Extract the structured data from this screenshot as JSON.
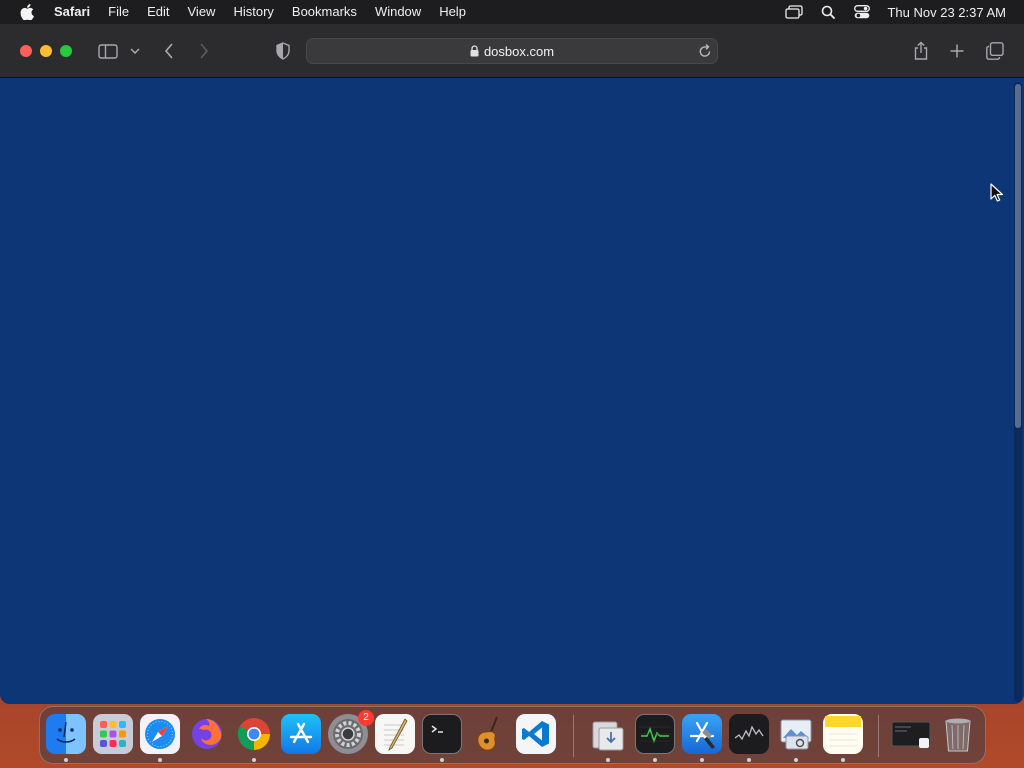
{
  "menubar": {
    "app_name": "Safari",
    "items": [
      "File",
      "Edit",
      "View",
      "History",
      "Bookmarks",
      "Window",
      "Help"
    ],
    "clock": "Thu Nov 23  2:37 AM",
    "icons": [
      "apple-icon",
      "screen-mirroring-icon",
      "spotlight-search-icon",
      "control-center-icon"
    ]
  },
  "browser": {
    "url": "dosbox.com",
    "page_background": "#0d3677"
  },
  "dock": {
    "apps": [
      {
        "name": "Finder",
        "running": true
      },
      {
        "name": "Launchpad",
        "running": false
      },
      {
        "name": "Safari",
        "running": true
      },
      {
        "name": "Firefox",
        "running": false
      },
      {
        "name": "Google Chrome",
        "running": true
      },
      {
        "name": "App Store",
        "running": false
      },
      {
        "name": "System Settings",
        "running": false,
        "badge": "2"
      },
      {
        "name": "TextEdit",
        "running": false
      },
      {
        "name": "Terminal",
        "running": true
      },
      {
        "name": "GarageBand",
        "running": false
      },
      {
        "name": "Visual Studio Code",
        "running": false
      },
      {
        "name": "Downloads",
        "running": true
      },
      {
        "name": "Activity Monitor",
        "running": true
      },
      {
        "name": "Xcode",
        "running": true
      },
      {
        "name": "Stocks",
        "running": true
      },
      {
        "name": "Preview",
        "running": true
      },
      {
        "name": "Notes",
        "running": true
      },
      {
        "name": "Window Preview",
        "running": false
      },
      {
        "name": "Trash",
        "running": false
      }
    ]
  }
}
